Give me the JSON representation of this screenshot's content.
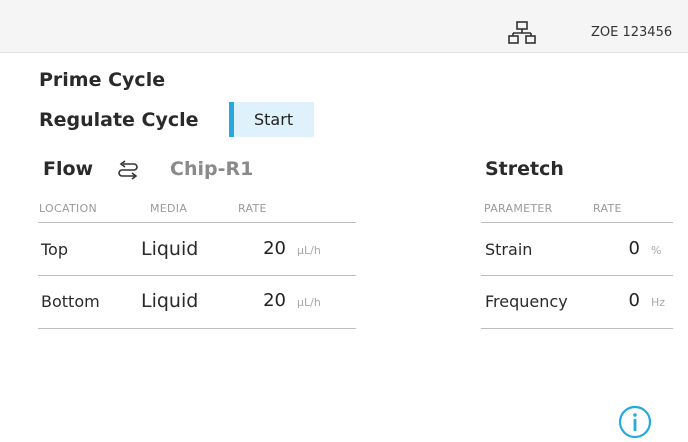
{
  "header": {
    "device_id": "ZOE 123456",
    "network_icon": "network-icon"
  },
  "cycles": {
    "prime_label": "Prime Cycle",
    "regulate_label": "Regulate Cycle",
    "start_label": "Start"
  },
  "flow": {
    "title": "Flow",
    "chip": "Chip-R1",
    "columns": [
      "LOCATION",
      "MEDIA",
      "RATE"
    ],
    "rows": [
      {
        "location": "Top",
        "media": "Liquid",
        "rate": "20",
        "unit": "µL/h"
      },
      {
        "location": "Bottom",
        "media": "Liquid",
        "rate": "20",
        "unit": "µL/h"
      }
    ]
  },
  "stretch": {
    "title": "Stretch",
    "columns": [
      "PARAMETER",
      "RATE"
    ],
    "rows": [
      {
        "parameter": "Strain",
        "rate": "0",
        "unit": "%"
      },
      {
        "parameter": "Frequency",
        "rate": "0",
        "unit": "Hz"
      }
    ]
  },
  "colors": {
    "accent": "#25a9e0",
    "button_bg": "#dff1fa"
  }
}
